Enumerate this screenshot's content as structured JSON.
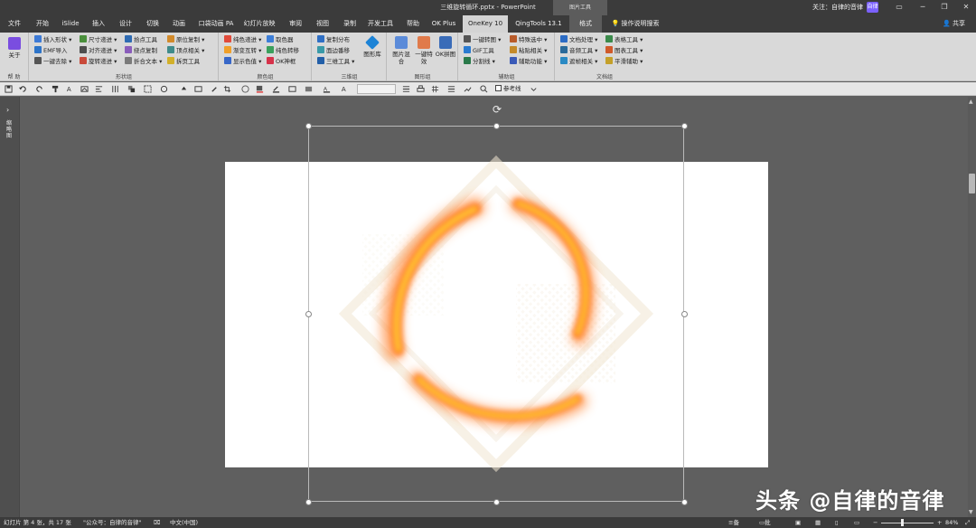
{
  "window": {
    "title": "三维旋转循环.pptx - PowerPoint",
    "context_tab_label": "图片工具",
    "user_label": "关注：自律的音律",
    "user_badge": "自律"
  },
  "tabs": [
    "文件",
    "开始",
    "iSlide",
    "插入",
    "设计",
    "切换",
    "动画",
    "口袋动画 PA",
    "幻灯片放映",
    "审阅",
    "视图",
    "录制",
    "开发工具",
    "帮助",
    "OK Plus",
    "OneKey 10",
    "QingTools 13.1",
    "格式",
    "操作说明搜索"
  ],
  "active_tab": "OneKey 10",
  "share_label": "共享",
  "ribbon": {
    "about": {
      "label": "关于",
      "group": "帮 助"
    },
    "shape_group": {
      "label": "形状组",
      "items": [
        "插入形状",
        "尺寸递进",
        "拾点工具",
        "原位复制",
        "EMF导入",
        "对齐递进",
        "绕点复制",
        "顶点相关",
        "一键去除",
        "旋转递进",
        "折合文本",
        "拆页工具"
      ]
    },
    "color_group": {
      "label": "颜色组",
      "items": [
        "纯色递进",
        "取色器",
        "渐变互转",
        "纯色转移",
        "显示色值",
        "OK神框"
      ]
    },
    "three_d_group": {
      "label": "三维组",
      "items": [
        "复制分布",
        "面边番移",
        "三维工具"
      ],
      "big": "图形库"
    },
    "image_group": {
      "label": "图形组",
      "big": [
        "图片混合",
        "一键特效",
        "OK拼图"
      ]
    },
    "assist_group": {
      "label": "辅助组",
      "items": [
        "一键转图",
        "特殊选中",
        "GIF工具",
        "粘贴相关",
        "分割线",
        "辅助功能"
      ]
    },
    "doc_group": {
      "label": "文档组",
      "items": [
        "文档处理",
        "表格工具",
        "音频工具",
        "图表工具",
        "遮帧相关",
        "平滑辅助"
      ]
    }
  },
  "qat": {
    "reference_line_label": "参考线"
  },
  "thumbnail_pane": {
    "label": "缩略图"
  },
  "watermark": "头条 @自律的音律",
  "status": {
    "slide_info": "幻灯片 第 4 张，共 17 张",
    "author": "\"公众号：自律的音律\"",
    "language": "中文(中国)",
    "notes": "备注",
    "comments": "批注",
    "zoom_minus": "−",
    "zoom_plus": "+",
    "zoom": "84%"
  },
  "colors": {
    "chrome_dark": "#3b3b3b",
    "ribbon_bg": "#d9d9d9",
    "workspace": "#5f5f5f",
    "active_tab_bg": "#d4d4d4",
    "fire_orange": "#ff7a1a",
    "fire_yellow": "#ffd23a"
  }
}
